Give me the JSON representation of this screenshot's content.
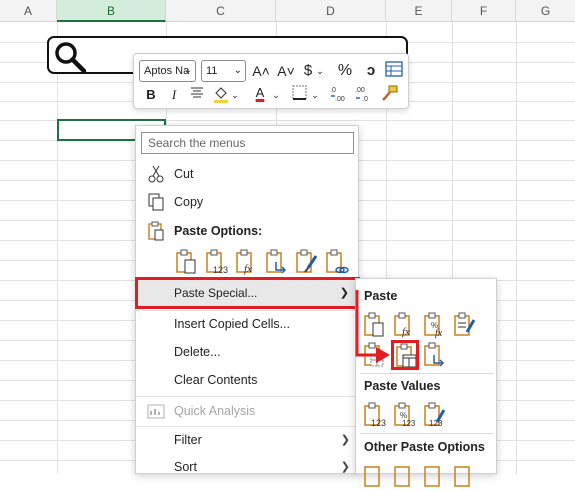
{
  "sheet": {
    "columns": [
      "A",
      "B",
      "C",
      "D",
      "E",
      "F",
      "G"
    ],
    "selected_column": "B"
  },
  "mini_toolbar": {
    "font_name": "Aptos Na",
    "font_size": "11",
    "increase_font": "A˄",
    "decrease_font": "A˅",
    "currency": "$",
    "percent": "%",
    "comma": "ɔ",
    "bold": "B",
    "italic": "I",
    "font_color_letter": "A",
    "colors": {
      "font_color": "#e31b23",
      "fill_color": "#f4d03f"
    }
  },
  "context_menu": {
    "search_placeholder": "Search the menus",
    "items": {
      "cut": "Cut",
      "copy": "Copy",
      "paste_options": "Paste Options:",
      "paste_special": "Paste Special...",
      "insert_copied_cells": "Insert Copied Cells...",
      "delete": "Delete...",
      "clear_contents": "Clear Contents",
      "quick_analysis": "Quick Analysis",
      "filter": "Filter",
      "sort": "Sort"
    }
  },
  "submenu": {
    "headers": {
      "paste": "Paste",
      "paste_values": "Paste Values",
      "other_paste_options": "Other Paste Options"
    }
  },
  "colors": {
    "accent": "#1e7145",
    "highlight_red": "#e31b23",
    "clip_orange": "#c8801e"
  }
}
